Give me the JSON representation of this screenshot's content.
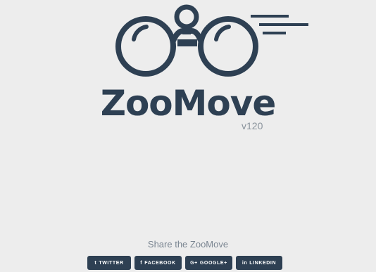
{
  "app": {
    "title": "ZooMove",
    "version": "v120"
  },
  "logo": {
    "icon": "binoculars-icon"
  },
  "share": {
    "heading": "Share the ZooMove",
    "buttons": [
      {
        "label": "TWITTER",
        "icon": "twitter-icon",
        "glyph": "t"
      },
      {
        "label": "FACEBOOK",
        "icon": "facebook-icon",
        "glyph": "f"
      },
      {
        "label": "GOOGLE+",
        "icon": "google-plus-icon",
        "glyph": "G+"
      },
      {
        "label": "LINKEDIN",
        "icon": "linkedin-icon",
        "glyph": "in"
      }
    ]
  },
  "colors": {
    "background": "#ededed",
    "primary": "#2e4053",
    "muted": "#7a8591"
  }
}
